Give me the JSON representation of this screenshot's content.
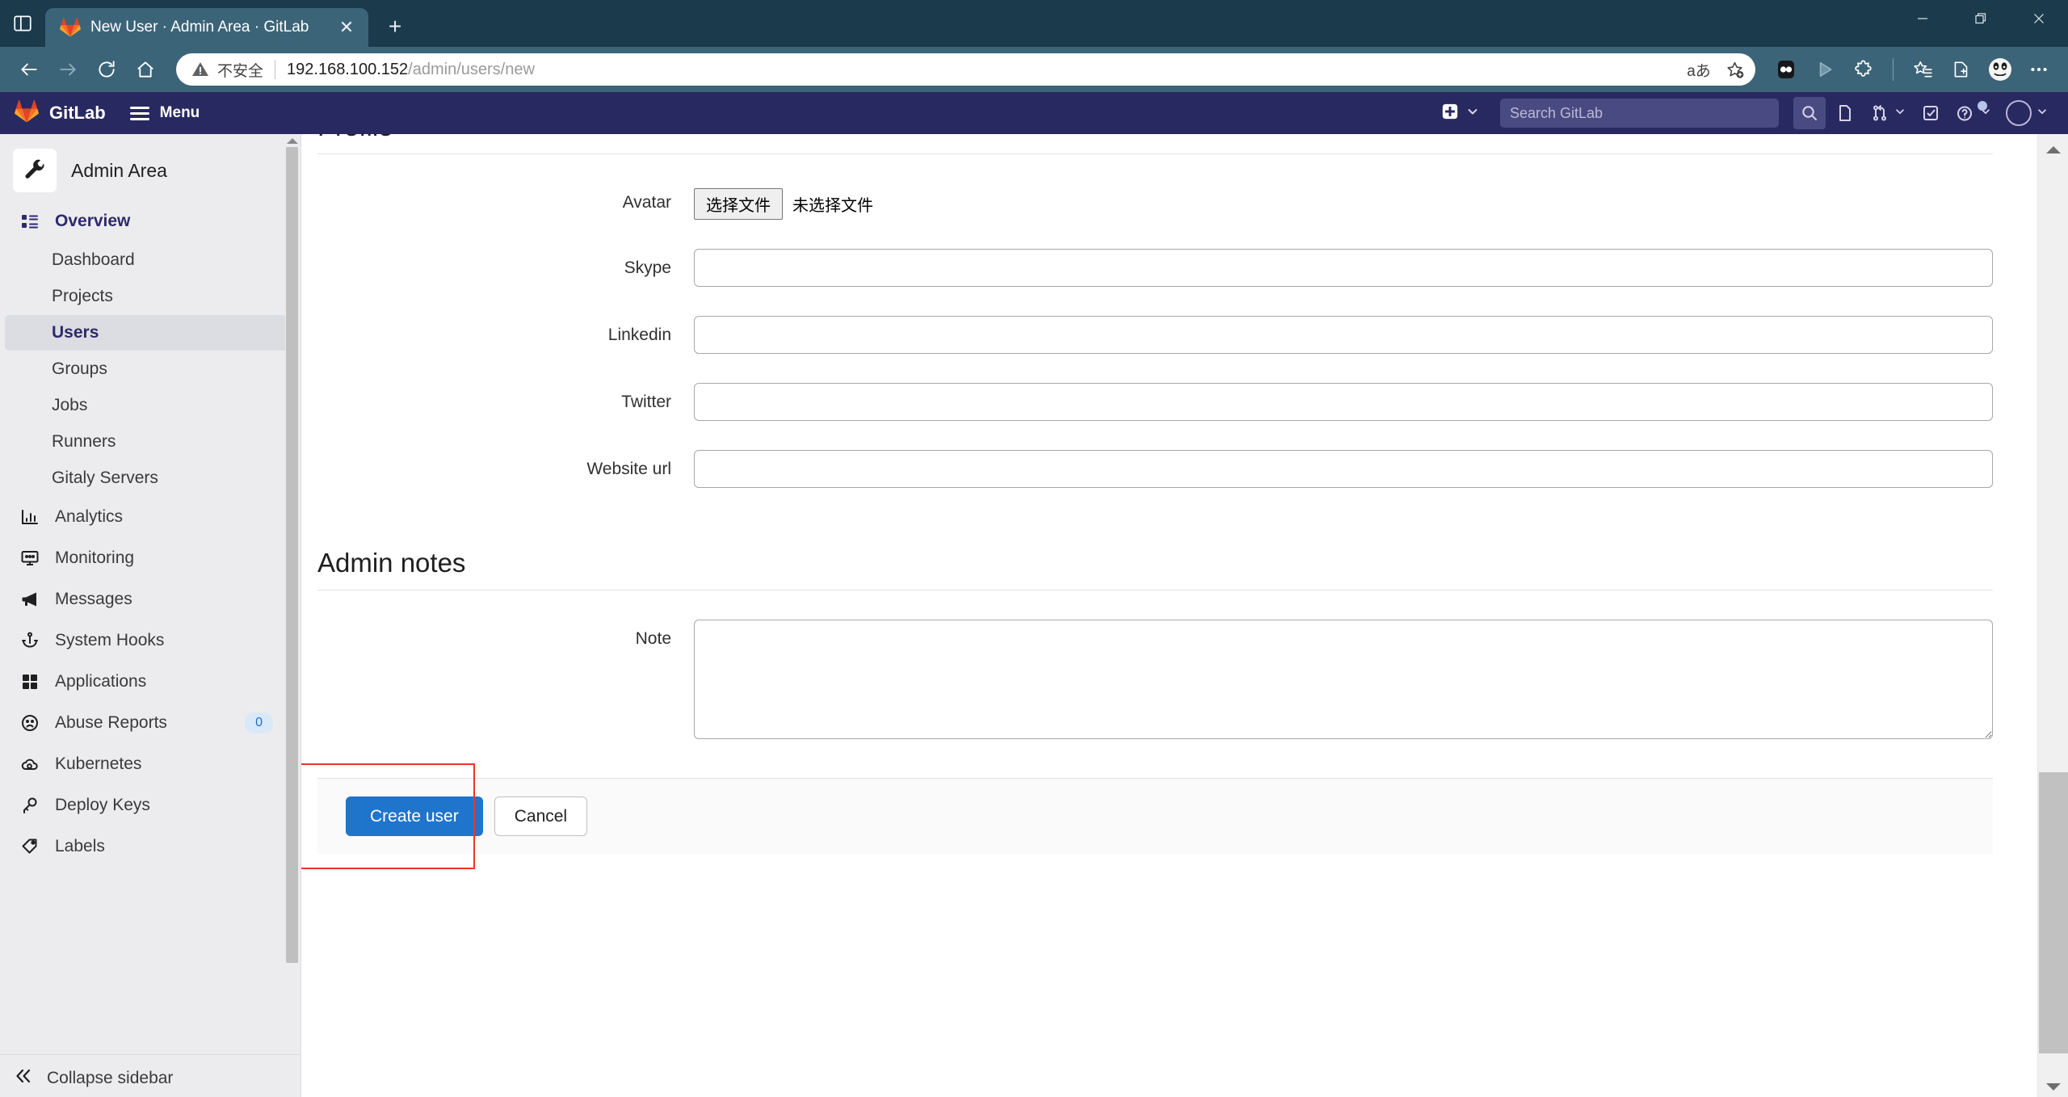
{
  "browser": {
    "tab": {
      "title": "New User · Admin Area · GitLab",
      "favicon": "gitlab-logo-icon",
      "close_label": "✕"
    },
    "new_tab_label": "+",
    "window_controls": {
      "minimize": "—",
      "restore": "❐",
      "close": "✕"
    },
    "toolbar": {
      "back": "back-icon",
      "forward": "forward-icon",
      "reload": "reload-icon",
      "home": "home-icon"
    },
    "omnibox": {
      "security_text": "不安全",
      "url_host": "192.168.100.152",
      "url_path": "/admin/users/new",
      "read_aloud_label": "aあ",
      "favorite_label": "favorites-add-icon"
    },
    "extensions": [
      "split-screen-icon",
      "play-icon",
      "extensions-puzzle-icon",
      "favorites-list-icon",
      "collections-icon",
      "profile-avatar-icon",
      "settings-more-icon"
    ]
  },
  "gitlab": {
    "brand": "GitLab",
    "menu_label": "Menu",
    "create_new_label": "create-new-icon",
    "search": {
      "placeholder": "Search GitLab",
      "value": ""
    },
    "nav_icons": [
      {
        "name": "search-icon",
        "label": ""
      },
      {
        "name": "issues-icon",
        "label": ""
      },
      {
        "name": "merge-requests-icon",
        "label": ""
      },
      {
        "name": "todos-icon",
        "label": ""
      },
      {
        "name": "help-icon",
        "label": ""
      },
      {
        "name": "user-avatar-icon",
        "label": ""
      }
    ]
  },
  "sidebar": {
    "context_title": "Admin Area",
    "context_icon": "wrench-icon",
    "overview": {
      "label": "Overview",
      "icon": "overview-icon"
    },
    "overview_children": [
      {
        "label": "Dashboard",
        "active": false
      },
      {
        "label": "Projects",
        "active": false
      },
      {
        "label": "Users",
        "active": true
      },
      {
        "label": "Groups",
        "active": false
      },
      {
        "label": "Jobs",
        "active": false
      },
      {
        "label": "Runners",
        "active": false
      },
      {
        "label": "Gitaly Servers",
        "active": false
      }
    ],
    "items": [
      {
        "label": "Analytics",
        "icon": "chart-bar-icon",
        "badge": ""
      },
      {
        "label": "Monitoring",
        "icon": "monitor-icon",
        "badge": ""
      },
      {
        "label": "Messages",
        "icon": "megaphone-icon",
        "badge": ""
      },
      {
        "label": "System Hooks",
        "icon": "hook-icon",
        "badge": ""
      },
      {
        "label": "Applications",
        "icon": "applications-grid-icon",
        "badge": ""
      },
      {
        "label": "Abuse Reports",
        "icon": "sad-face-icon",
        "badge": "0"
      },
      {
        "label": "Kubernetes",
        "icon": "cloud-gear-icon",
        "badge": ""
      },
      {
        "label": "Deploy Keys",
        "icon": "key-icon",
        "badge": ""
      },
      {
        "label": "Labels",
        "icon": "tag-icon",
        "badge": ""
      }
    ],
    "collapse": {
      "label": "Collapse sidebar",
      "icon": "chevron-double-left-icon"
    }
  },
  "main": {
    "profile_section_title": "Profile",
    "fields": [
      {
        "label": "Avatar",
        "type": "file",
        "button_label": "选择文件",
        "status_text": "未选择文件"
      },
      {
        "label": "Skype",
        "type": "text",
        "value": ""
      },
      {
        "label": "Linkedin",
        "type": "text",
        "value": ""
      },
      {
        "label": "Twitter",
        "type": "text",
        "value": ""
      },
      {
        "label": "Website url",
        "type": "text",
        "value": ""
      }
    ],
    "admin_notes_section_title": "Admin notes",
    "note": {
      "label": "Note",
      "value": ""
    },
    "actions": {
      "create_label": "Create user",
      "cancel_label": "Cancel",
      "highlight_color": "#e8362b"
    }
  }
}
